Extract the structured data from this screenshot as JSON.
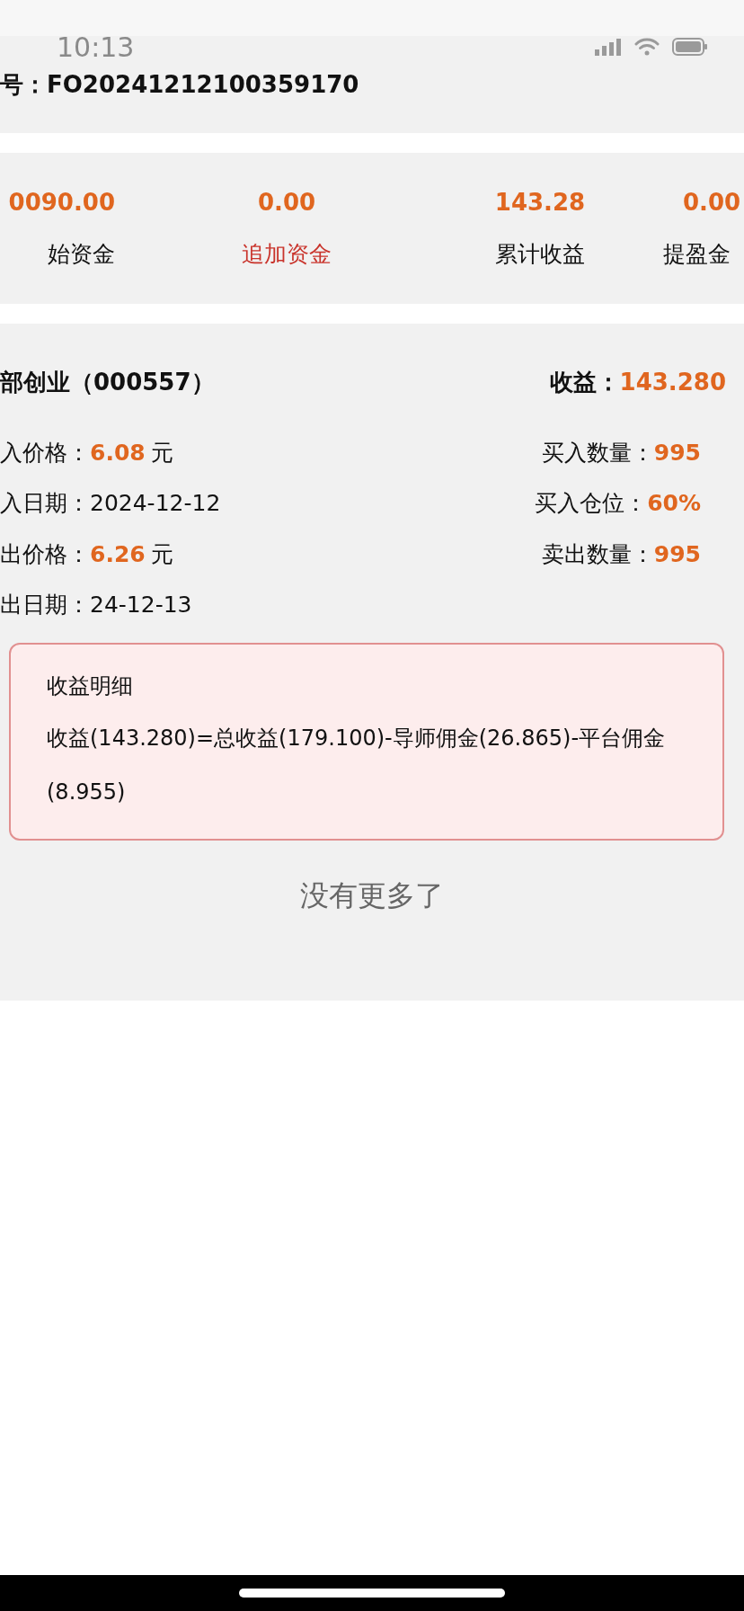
{
  "status_bar": {
    "time": "10:13"
  },
  "order": {
    "label": "号：",
    "number": "FO20241212100359170"
  },
  "stats": [
    {
      "value": "0090.00",
      "label": "始资金",
      "kind": "plain"
    },
    {
      "value": "0.00",
      "label": "追加资金",
      "kind": "link"
    },
    {
      "value": "143.28",
      "label": "累计收益",
      "kind": "plain"
    },
    {
      "value": "0.00",
      "label": "提盈金",
      "kind": "plain"
    }
  ],
  "trade": {
    "stock": "部创业（000557）",
    "profit_label": "收益：",
    "profit_value": "143.280",
    "left": [
      {
        "label": "入价格：",
        "value": "6.08",
        "unit": "元",
        "highlight": true
      },
      {
        "label": "入日期：",
        "value": "2024-12-12",
        "highlight": false
      },
      {
        "label": "出价格：",
        "value": "6.26",
        "unit": "元",
        "highlight": true
      },
      {
        "label": "出日期：",
        "value": "24-12-13",
        "highlight": false
      }
    ],
    "right": [
      {
        "label": "买入数量：",
        "value": "995",
        "highlight": true
      },
      {
        "label": "买入仓位：",
        "value": "60%",
        "highlight": true
      },
      {
        "label": "卖出数量：",
        "value": "995",
        "highlight": true
      }
    ],
    "detail": {
      "title": "收益明细",
      "text": "收益(143.280)=总收益(179.100)-导师佣金(26.865)-平台佣金(8.955)"
    }
  },
  "end_text": "没有更多了"
}
